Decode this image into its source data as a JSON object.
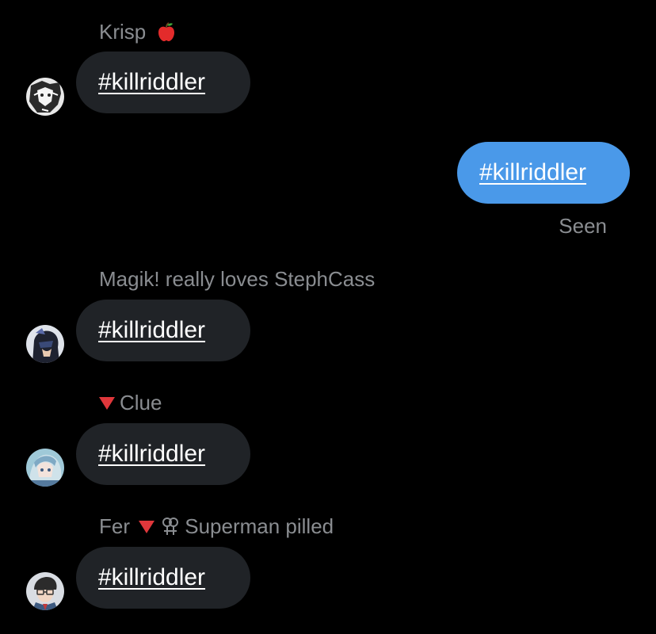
{
  "messages": [
    {
      "sender": "Krisp",
      "sender_suffix_icon": "apple-icon",
      "text": "#killriddler",
      "direction": "incoming",
      "avatar": "manga-avatar-icon"
    },
    {
      "text": "#killriddler",
      "direction": "outgoing",
      "status": "Seen"
    },
    {
      "sender": "Magik! really loves StephCass",
      "text": "#killriddler",
      "direction": "incoming",
      "avatar": "masked-hero-avatar-icon"
    },
    {
      "sender": "Clue",
      "sender_prefix_icon": "red-triangle-icon",
      "text": "#killriddler",
      "direction": "incoming",
      "avatar": "anime-girl-avatar-icon"
    },
    {
      "sender": "Fer",
      "sender_middle_icons": [
        "red-triangle-icon",
        "lesbian-symbol-icon"
      ],
      "sender_rest": "Superman pilled",
      "text": "#killriddler",
      "direction": "incoming",
      "avatar": "glasses-man-avatar-icon"
    }
  ],
  "colors": {
    "background": "#000000",
    "incoming_bubble": "#202327",
    "outgoing_bubble": "#4a99e9",
    "meta_text": "#8a8d91",
    "triangle": "#e0373b"
  }
}
